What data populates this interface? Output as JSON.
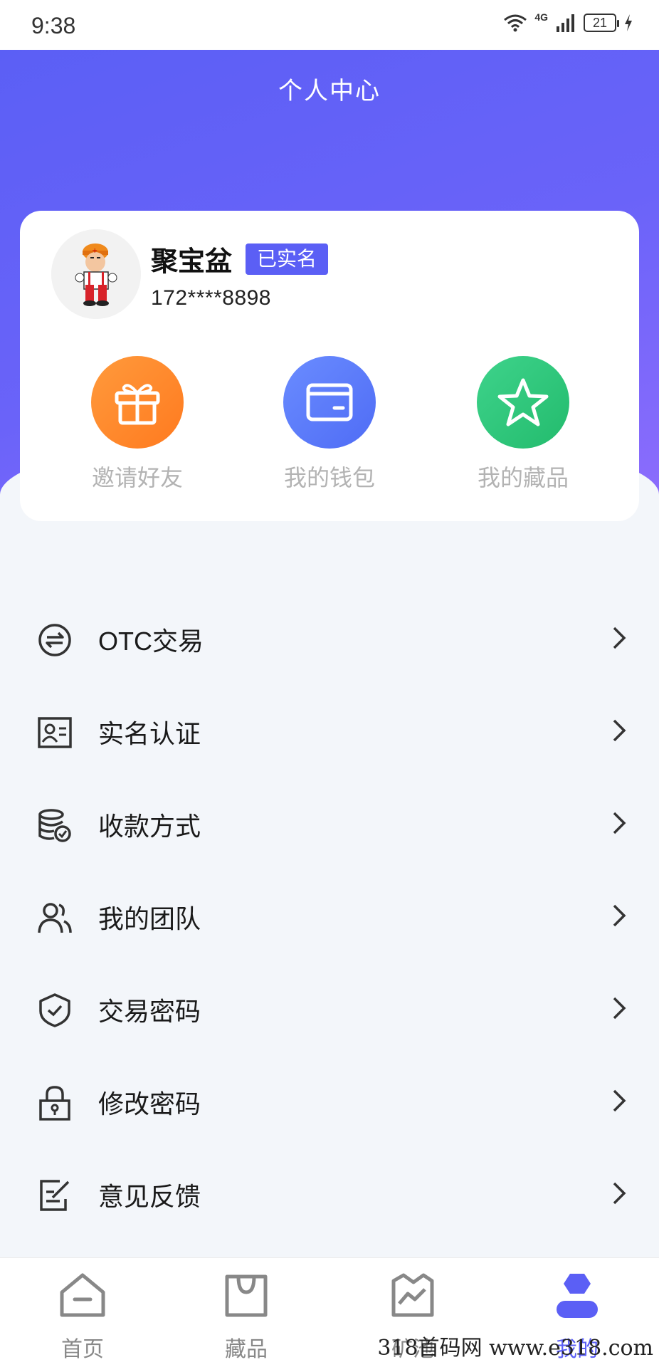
{
  "status_bar": {
    "time": "9:38",
    "network": "4G",
    "battery": "21"
  },
  "header": {
    "title": "个人中心"
  },
  "profile": {
    "name": "聚宝盆",
    "badge": "已实名",
    "phone": "172****8898"
  },
  "quick_actions": [
    {
      "label": "邀请好友",
      "icon": "gift-icon",
      "color": "#ff8a2a"
    },
    {
      "label": "我的钱包",
      "icon": "wallet-icon",
      "color": "#5b78f7"
    },
    {
      "label": "我的藏品",
      "icon": "star-icon",
      "color": "#2fc77a"
    }
  ],
  "menu": [
    {
      "label": "OTC交易",
      "icon": "exchange-icon"
    },
    {
      "label": "实名认证",
      "icon": "id-card-icon"
    },
    {
      "label": "收款方式",
      "icon": "coins-check-icon"
    },
    {
      "label": "我的团队",
      "icon": "team-icon"
    },
    {
      "label": "交易密码",
      "icon": "shield-check-icon"
    },
    {
      "label": "修改密码",
      "icon": "lock-icon"
    },
    {
      "label": "意见反馈",
      "icon": "feedback-icon"
    }
  ],
  "tabs": [
    {
      "label": "首页",
      "icon": "home-icon",
      "active": false
    },
    {
      "label": "藏品",
      "icon": "bag-icon",
      "active": false
    },
    {
      "label": "矿池",
      "icon": "chart-icon",
      "active": false
    },
    {
      "label": "我的",
      "icon": "profile-icon",
      "active": true
    }
  ],
  "theme": {
    "primary": "#5b5ff5",
    "background": "#f3f6fa"
  },
  "watermark": "318首码网 www.e318.com"
}
